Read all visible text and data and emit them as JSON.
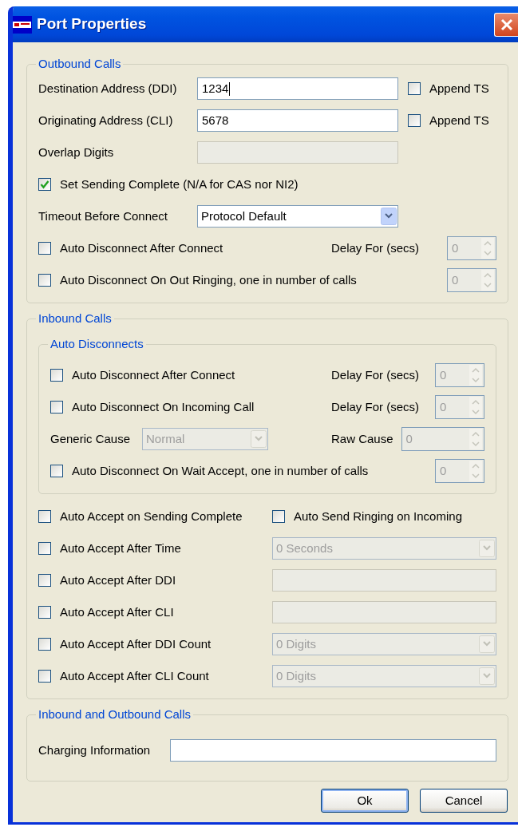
{
  "window": {
    "title": "Port Properties"
  },
  "sections": [
    {
      "title": "Outbound Calls",
      "rows": [
        {
          "kind": "field",
          "label": "Destination Address (DDI)",
          "value": "1234",
          "focused": true,
          "disabled": false,
          "append": {
            "label": "Append TS",
            "checked": false
          }
        },
        {
          "kind": "field",
          "label": "Originating Address (CLI)",
          "value": "5678",
          "focused": false,
          "disabled": false,
          "append": {
            "label": "Append TS",
            "checked": false
          }
        },
        {
          "kind": "field",
          "label": "Overlap Digits",
          "focused": false,
          "disabled": true
        },
        {
          "kind": "check",
          "label": "Set Sending Complete (N/A for CAS nor NI2)",
          "checked": true
        },
        {
          "kind": "select",
          "label": "Timeout Before Connect",
          "value": "Protocol Default",
          "disabled": false
        },
        {
          "kind": "check-spin",
          "label": "Auto Disconnect After Connect",
          "checked": false,
          "spin_label": "Delay For (secs)",
          "spin_value": "0",
          "disabled": true
        },
        {
          "kind": "check-spin",
          "label": "Auto Disconnect On Out Ringing, one in number of calls",
          "checked": false,
          "spin_value": "0",
          "disabled": true
        }
      ]
    },
    {
      "title": "Inbound Calls",
      "group": {
        "title": "Auto Disconnects",
        "rows": [
          {
            "kind": "check-spin",
            "label": "Auto Disconnect After Connect",
            "checked": false,
            "spin_label": "Delay For (secs)",
            "spin_value": "0",
            "disabled": true
          },
          {
            "kind": "check-spin",
            "label": "Auto Disconnect On Incoming Call",
            "checked": false,
            "spin_label": "Delay For (secs)",
            "spin_value": "0",
            "disabled": true
          },
          {
            "kind": "cause",
            "label": "Generic Cause",
            "value": "Normal",
            "spin_label": "Raw Cause",
            "spin_value": "0",
            "disabled": true
          },
          {
            "kind": "check-spin",
            "label": "Auto Disconnect On Wait Accept, one in number of calls",
            "checked": false,
            "spin_value": "0",
            "disabled": true
          }
        ]
      },
      "rows": [
        {
          "kind": "check-pair",
          "label": "Auto Accept on Sending Complete",
          "checked": false,
          "second": {
            "label": "Auto Send Ringing on Incoming",
            "checked": false
          }
        },
        {
          "kind": "check-select",
          "label": "Auto Accept After Time",
          "checked": false,
          "value": "0 Seconds",
          "disabled": true
        },
        {
          "kind": "check-field",
          "label": "Auto Accept After DDI",
          "checked": false,
          "disabled": true
        },
        {
          "kind": "check-field",
          "label": "Auto Accept After CLI",
          "checked": false,
          "disabled": true
        },
        {
          "kind": "check-select",
          "label": "Auto Accept After DDI Count",
          "checked": false,
          "value": "0 Digits",
          "disabled": true
        },
        {
          "kind": "check-select",
          "label": "Auto Accept After CLI Count",
          "checked": false,
          "value": "0 Digits",
          "disabled": true
        }
      ]
    },
    {
      "title": "Inbound and Outbound Calls",
      "rows": [
        {
          "kind": "wide-field",
          "label": "Charging Information",
          "disabled": false
        }
      ]
    }
  ],
  "buttons": [
    {
      "label": "Ok",
      "default": true
    },
    {
      "label": "Cancel",
      "default": false
    }
  ]
}
